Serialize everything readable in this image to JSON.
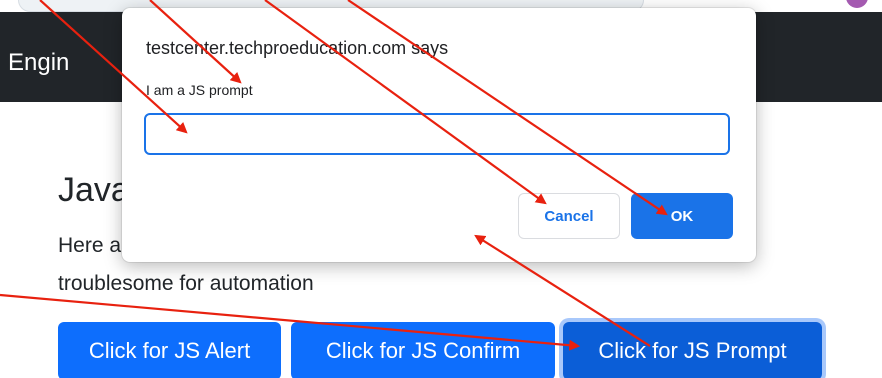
{
  "navbar": {
    "brand": "n Engin"
  },
  "page": {
    "heading": "Java",
    "description": "Here a                                                                                              an be troublesome for automation"
  },
  "buttons": {
    "alert": "Click for JS Alert",
    "confirm": "Click for JS Confirm",
    "prompt": "Click for JS Prompt"
  },
  "dialog": {
    "origin": "testcenter.techproeducation.com says",
    "message": "I am a JS prompt",
    "input_value": "",
    "cancel": "Cancel",
    "ok": "OK"
  },
  "colors": {
    "navbar": "#212529",
    "primary": "#0d6efd",
    "dialog_accent": "#1a73e8",
    "annotation": "#e8210f"
  }
}
